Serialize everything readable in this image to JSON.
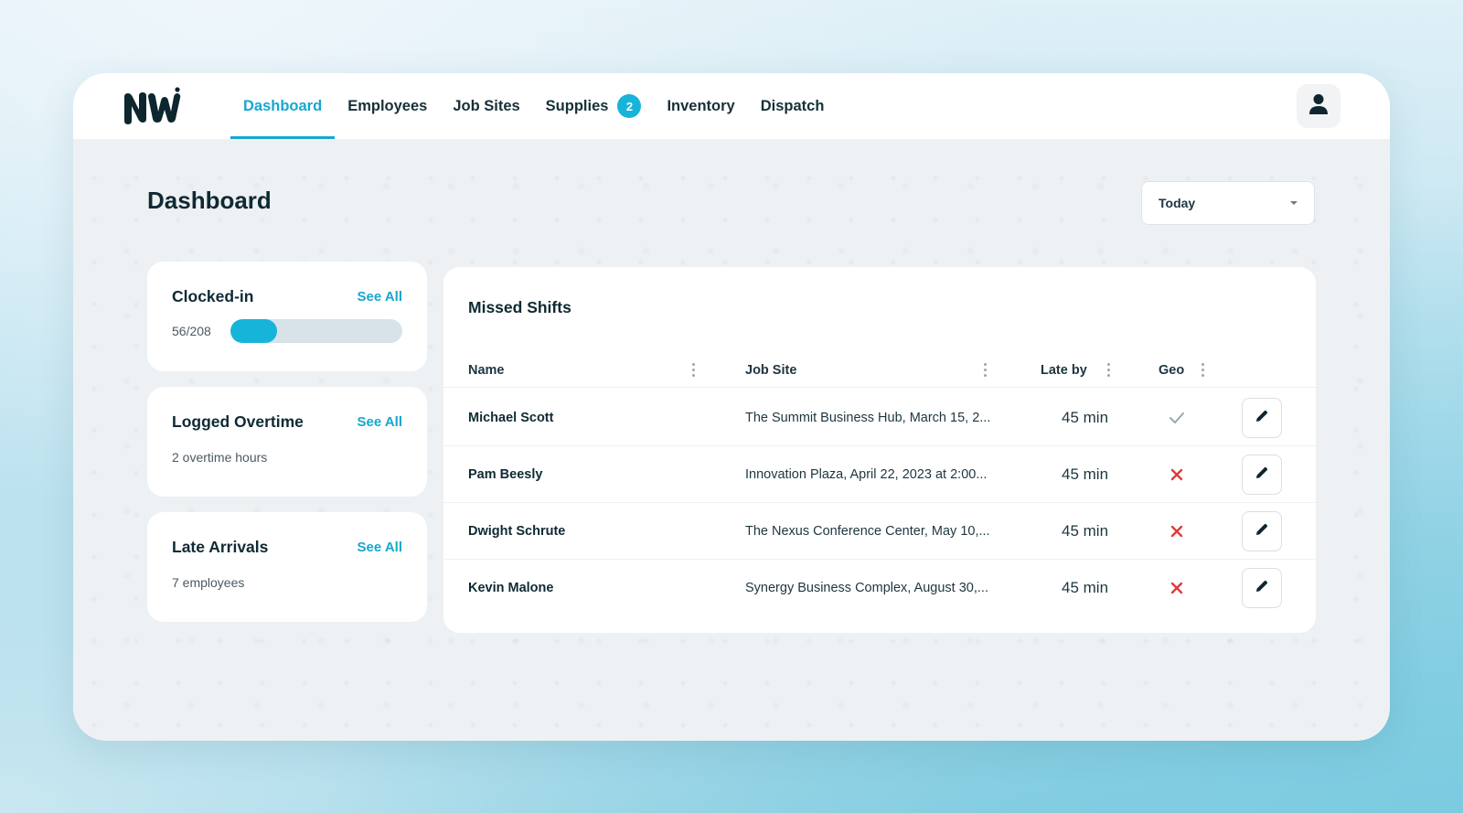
{
  "nav": {
    "items": [
      {
        "label": "Dashboard",
        "active": true
      },
      {
        "label": "Employees",
        "active": false
      },
      {
        "label": "Job Sites",
        "active": false
      },
      {
        "label": "Supplies",
        "active": false,
        "badge": "2"
      },
      {
        "label": "Inventory",
        "active": false
      },
      {
        "label": "Dispatch",
        "active": false
      }
    ]
  },
  "page": {
    "title": "Dashboard"
  },
  "date_filter": {
    "selected": "Today"
  },
  "cards": {
    "clocked_in": {
      "title": "Clocked-in",
      "link": "See All",
      "value": "56/208",
      "progress": 0.27
    },
    "overtime": {
      "title": "Logged Overtime",
      "link": "See All",
      "subtitle": "2 overtime hours"
    },
    "late": {
      "title": "Late Arrivals",
      "link": "See All",
      "subtitle": "7 employees"
    }
  },
  "missed_shifts": {
    "title": "Missed Shifts",
    "columns": [
      "Name",
      "Job Site",
      "Late by",
      "Geo"
    ],
    "rows": [
      {
        "name": "Michael Scott",
        "site": "The Summit Business Hub, March 15, 2...",
        "late": "45 min",
        "geo": "check"
      },
      {
        "name": "Pam Beesly",
        "site": "Innovation Plaza, April 22, 2023 at 2:00...",
        "late": "45 min",
        "geo": "x"
      },
      {
        "name": "Dwight Schrute",
        "site": "The Nexus Conference Center, May 10,...",
        "late": "45 min",
        "geo": "x"
      },
      {
        "name": "Kevin Malone",
        "site": "Synergy Business Complex, August 30,...",
        "late": "45 min",
        "geo": "x"
      }
    ]
  },
  "colors": {
    "accent": "#17a7cf",
    "badge": "#17b4d9",
    "error": "#e03a3a",
    "check": "#9aa7ad"
  }
}
